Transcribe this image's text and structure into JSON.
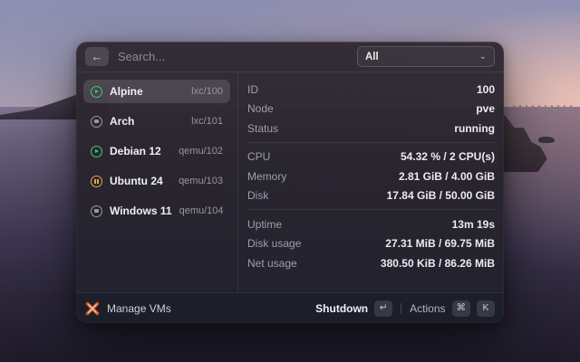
{
  "header": {
    "search_placeholder": "Search...",
    "back_icon": "←",
    "filter_selected": "All",
    "chevron_icon": "⌄"
  },
  "vms": [
    {
      "name": "Alpine",
      "id": "lxc/100",
      "state": "running",
      "selected": true
    },
    {
      "name": "Arch",
      "id": "lxc/101",
      "state": "stopped",
      "selected": false
    },
    {
      "name": "Debian 12",
      "id": "qemu/102",
      "state": "running",
      "selected": false
    },
    {
      "name": "Ubuntu 24",
      "id": "qemu/103",
      "state": "paused",
      "selected": false
    },
    {
      "name": "Windows 11",
      "id": "qemu/104",
      "state": "stopped",
      "selected": false
    }
  ],
  "details": {
    "section1": [
      {
        "label": "ID",
        "value": "100"
      },
      {
        "label": "Node",
        "value": "pve"
      },
      {
        "label": "Status",
        "value": "running"
      }
    ],
    "section2": [
      {
        "label": "CPU",
        "value": "54.32 % / 2 CPU(s)"
      },
      {
        "label": "Memory",
        "value": "2.81 GiB / 4.00 GiB"
      },
      {
        "label": "Disk",
        "value": "17.84 GiB / 50.00 GiB"
      }
    ],
    "section3": [
      {
        "label": "Uptime",
        "value": "13m 19s"
      },
      {
        "label": "Disk usage",
        "value": "27.31 MiB / 69.75 MiB"
      },
      {
        "label": "Net usage",
        "value": "380.50 KiB / 86.26 MiB"
      }
    ]
  },
  "footer": {
    "manage_label": "Manage VMs",
    "primary_action": "Shutdown",
    "primary_key": "↵",
    "actions_label": "Actions",
    "cmd_key": "⌘",
    "k_key": "K"
  },
  "colors": {
    "running": "#3ecf6d",
    "paused": "#e8a33c",
    "stopped": "#9b97a1",
    "proxmox_orange": "#e25e12"
  }
}
